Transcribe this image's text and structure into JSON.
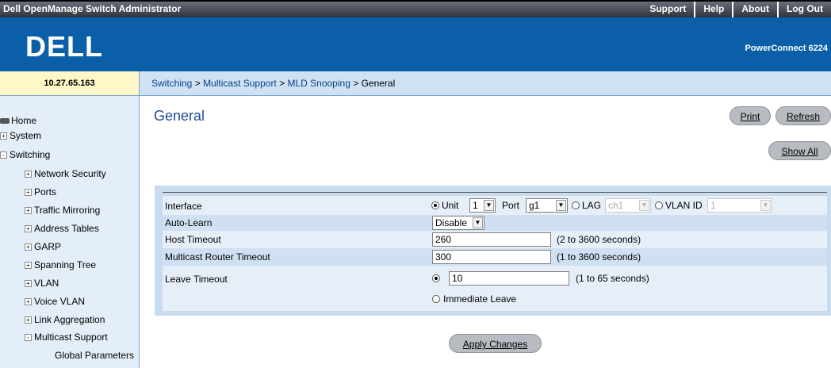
{
  "app": {
    "title": "Dell OpenManage Switch Administrator",
    "logo": "DELL",
    "model": "PowerConnect 6224"
  },
  "topnav": [
    "Support",
    "Help",
    "About",
    "Log Out"
  ],
  "ip": "10.27.65.163",
  "breadcrumb": {
    "items": [
      "Switching",
      "Multicast Support",
      "MLD Snooping"
    ],
    "separator": ">",
    "current": "General"
  },
  "sidebar": [
    {
      "label": "Home",
      "icon": "home-icon"
    },
    {
      "label": "System",
      "expander": "+"
    },
    {
      "label": "Switching",
      "expander": "-"
    },
    {
      "label": "Network Security",
      "expander": "+"
    },
    {
      "label": "Ports",
      "expander": "+"
    },
    {
      "label": "Traffic Mirroring",
      "expander": "+"
    },
    {
      "label": "Address Tables",
      "expander": "+"
    },
    {
      "label": "GARP",
      "expander": "+"
    },
    {
      "label": "Spanning Tree",
      "expander": "+"
    },
    {
      "label": "VLAN",
      "expander": "+"
    },
    {
      "label": "Voice VLAN",
      "expander": "+"
    },
    {
      "label": "Link Aggregation",
      "expander": "+"
    },
    {
      "label": "Multicast Support",
      "expander": "-"
    },
    {
      "label": "Global Parameters"
    }
  ],
  "page": {
    "title": "General",
    "print": "Print",
    "refresh": "Refresh",
    "show_all": "Show All",
    "apply": "Apply Changes"
  },
  "form": {
    "interface": {
      "label": "Interface",
      "unit_label": "Unit",
      "unit_value": "1",
      "port_label": "Port",
      "port_value": "g1",
      "lag_label": "LAG",
      "lag_value": "ch1",
      "vlan_label": "VLAN ID",
      "vlan_value": "1",
      "selected": "Unit"
    },
    "auto_learn": {
      "label": "Auto-Learn",
      "value": "Disable"
    },
    "host_timeout": {
      "label": "Host Timeout",
      "value": "260",
      "hint": "(2 to 3600 seconds)"
    },
    "router_timeout": {
      "label": "Multicast Router Timeout",
      "value": "300",
      "hint": "(1 to 3600 seconds)"
    },
    "leave_timeout": {
      "label": "Leave Timeout",
      "value": "10",
      "hint": "(1 to 65 seconds)",
      "immediate_label": "Immediate Leave",
      "selected": "value"
    }
  },
  "colors": {
    "brand": "#0a5fa8",
    "panel": "#c8dbef",
    "sidebar": "#e4eef8",
    "title": "#1b4f91"
  }
}
